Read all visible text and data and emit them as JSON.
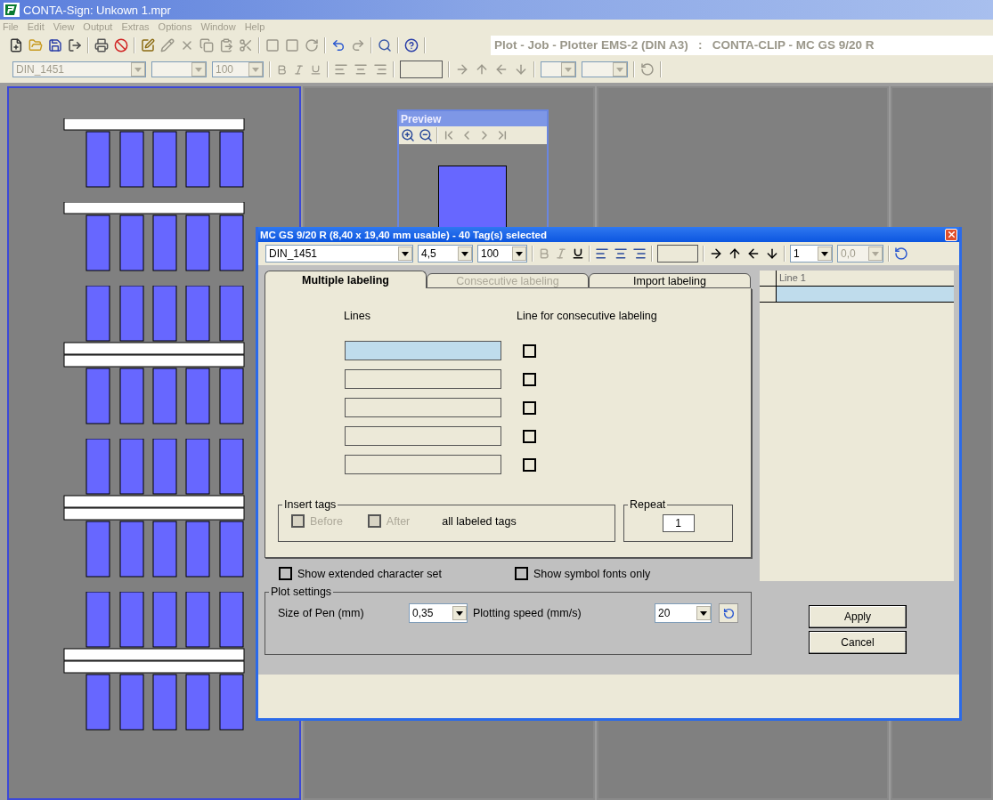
{
  "window": {
    "title": "CONTA-Sign: Unkown 1.mpr"
  },
  "menu": [
    {
      "label": "File",
      "disabled": true
    },
    {
      "label": "Edit",
      "disabled": true
    },
    {
      "label": "View",
      "disabled": true
    },
    {
      "label": "Output",
      "disabled": true
    },
    {
      "label": "Extras",
      "disabled": true
    },
    {
      "label": "Options",
      "disabled": true
    },
    {
      "label": "Window",
      "disabled": true
    },
    {
      "label": "Help",
      "disabled": true
    }
  ],
  "toolbar": {
    "job_info": "Plot - Job - Plotter EMS-2 (DIN A3)   :   CONTA-CLIP - MC GS 9/20 R"
  },
  "format_bar": {
    "disabled": true,
    "font": "DIN_1451",
    "scale": "100"
  },
  "workspace": {
    "panels": [
      {
        "selected": true
      },
      {
        "selected": false
      },
      {
        "selected": false
      },
      {
        "selected": false
      }
    ]
  },
  "preview": {
    "title": "Preview"
  },
  "dialog": {
    "title": "MC GS 9/20 R (8,40 x 19,40 mm usable) - 40 Tag(s) selected",
    "font": "DIN_1451",
    "size": "4,5",
    "scale": "100",
    "style_buttons": [
      {
        "kind": "bold",
        "disabled": true
      },
      {
        "kind": "italic",
        "disabled": true
      },
      {
        "kind": "underline",
        "disabled": false
      }
    ],
    "line_number": "1",
    "offset": {
      "value": "0,0",
      "disabled": true
    },
    "tabs": [
      {
        "label": "Multiple labeling",
        "selected": true,
        "disabled": false
      },
      {
        "label": "Consecutive labeling",
        "selected": false,
        "disabled": true
      },
      {
        "label": "Import labeling",
        "selected": false,
        "disabled": false
      }
    ],
    "lines_header": "Lines",
    "consecutive_header": "Line for consecutive labeling",
    "lines": [
      {
        "focused": true,
        "consecutive": false
      },
      {
        "focused": false,
        "consecutive": false
      },
      {
        "focused": false,
        "consecutive": false
      },
      {
        "focused": false,
        "consecutive": false
      },
      {
        "focused": false,
        "consecutive": false
      }
    ],
    "insert_tags": {
      "title": "Insert tags",
      "options": [
        {
          "label": "Before",
          "checked": false,
          "disabled": true
        },
        {
          "label": "After",
          "checked": false,
          "disabled": true
        }
      ],
      "suffix": "all labeled tags"
    },
    "repeat": {
      "title": "Repeat",
      "value": "1"
    },
    "options": [
      {
        "label": "Show extended character set",
        "checked": false
      },
      {
        "label": "Show symbol fonts only",
        "checked": false
      }
    ],
    "plot_settings": {
      "title": "Plot settings",
      "pen_label": "Size of Pen (mm)",
      "pen_value": "0,35",
      "speed_label": "Plotting speed (mm/s)",
      "speed_value": "20"
    },
    "line_table": {
      "columns": [
        "Line 1"
      ],
      "rows": [
        {
          "selected": true
        }
      ]
    },
    "buttons": [
      {
        "label": "Apply"
      },
      {
        "label": "Cancel"
      }
    ]
  }
}
